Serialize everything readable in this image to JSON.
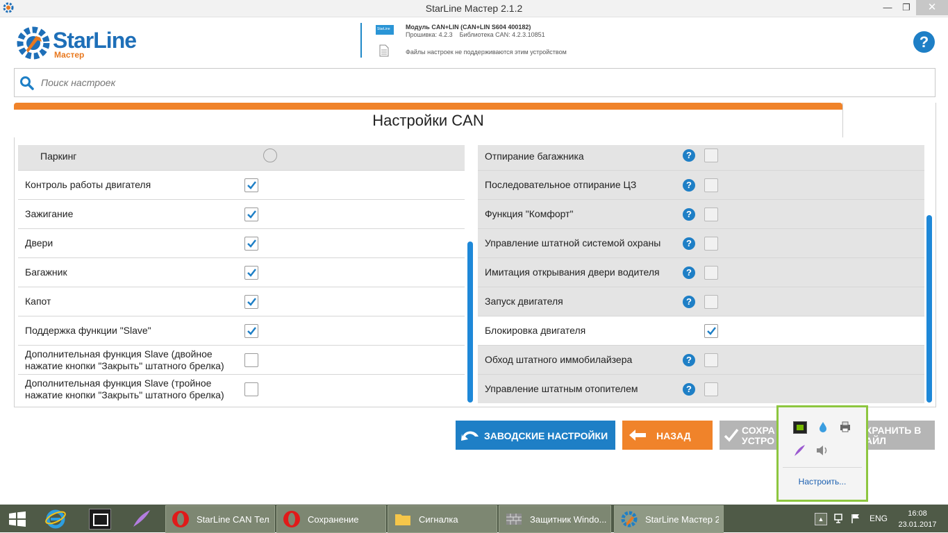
{
  "window": {
    "title": "StarLine Мастер 2.1.2"
  },
  "logo": {
    "brand": "StarLine",
    "sub": "Мастер"
  },
  "device": {
    "title": "Модуль CAN+LIN (CAN+LIN S604 400182)",
    "firmware": "Прошивка: 4.2.3    Библиотека CAN: 4.2.3.10851",
    "files_note": "Файлы настроек не поддерживаются этим устройством",
    "chip_label": "StarLine"
  },
  "search": {
    "placeholder": "Поиск настроек"
  },
  "panel": {
    "title": "Настройки CAN"
  },
  "left_rows": [
    {
      "label": "Паркинг",
      "type": "radio",
      "checked": false
    },
    {
      "label": "Контроль работы двигателя",
      "type": "check",
      "checked": true
    },
    {
      "label": "Зажигание",
      "type": "check",
      "checked": true
    },
    {
      "label": "Двери",
      "type": "check",
      "checked": true
    },
    {
      "label": "Багажник",
      "type": "check",
      "checked": true
    },
    {
      "label": "Капот",
      "type": "check",
      "checked": true
    },
    {
      "label": "Поддержка функции \"Slave\"",
      "type": "check",
      "checked": true
    },
    {
      "label": "Дополнительная функция Slave (двойное нажатие кнопки \"Закрыть\" штатного брелка)",
      "line1": "Дополнительная функция Slave (двойное",
      "line2": "нажатие кнопки \"Закрыть\" штатного брелка)",
      "type": "check",
      "checked": false
    },
    {
      "label": "Дополнительная функция Slave (тройное нажатие кнопки \"Закрыть\" штатного брелка)",
      "line1": "Дополнительная функция Slave (тройное",
      "line2": "нажатие кнопки \"Закрыть\" штатного брелка)",
      "type": "check",
      "checked": false
    }
  ],
  "right_rows": [
    {
      "label": "Отпирание багажника",
      "help": true,
      "checked": false
    },
    {
      "label": "Последовательное отпирание ЦЗ",
      "help": true,
      "checked": false
    },
    {
      "label": "Функция \"Комфорт\"",
      "help": true,
      "checked": false
    },
    {
      "label": "Управление штатной системой охраны",
      "help": true,
      "checked": false
    },
    {
      "label": "Имитация открывания двери водителя",
      "help": true,
      "checked": false
    },
    {
      "label": "Запуск двигателя",
      "help": true,
      "checked": false
    },
    {
      "label": "Блокировка двигателя",
      "help": false,
      "checked": true
    },
    {
      "label": "Обход штатного иммобилайзера",
      "help": true,
      "checked": false
    },
    {
      "label": "Управление штатным отопителем",
      "help": true,
      "checked": false
    }
  ],
  "buttons": {
    "factory": "ЗАВОДСКИЕ НАСТРОЙКИ",
    "back": "НАЗАД",
    "save_device_l1": "СОХРА",
    "save_device_l2": "УСТРО",
    "save_file_l1": "ХРАНИТЬ В",
    "save_file_l2": "АЙЛ"
  },
  "tray_popup": {
    "customize": "Настроить..."
  },
  "taskbar": {
    "items": [
      "StarLine CAN Тел...",
      "Сохранение",
      "Сигналка",
      "Защитник Windo...",
      "StarLine Мастер 2..."
    ],
    "lang": "ENG",
    "time": "16:08",
    "date": "23.01.2017"
  },
  "colors": {
    "accent_blue": "#1e7fc6",
    "accent_orange": "#f0832a",
    "disabled": "#b5b5b5",
    "tray_border": "#8dc63f"
  }
}
